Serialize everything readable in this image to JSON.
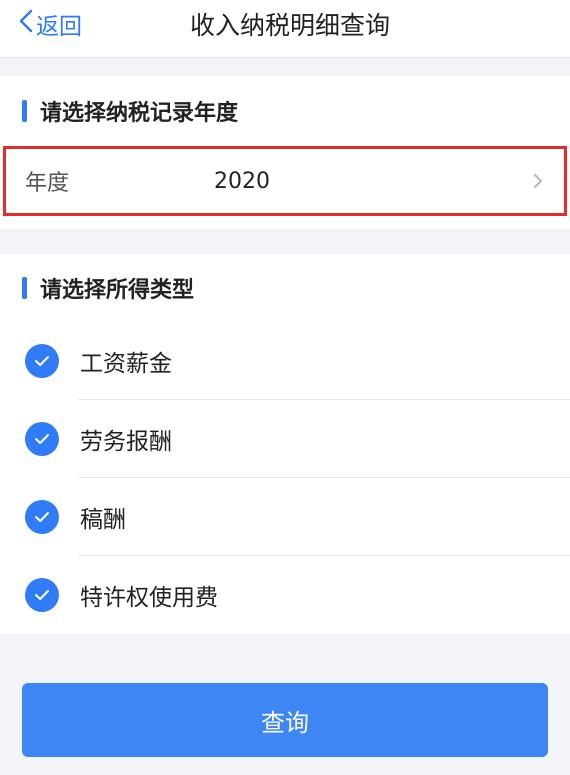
{
  "nav": {
    "back_label": "返回",
    "title": "收入纳税明细查询"
  },
  "year_section": {
    "title": "请选择纳税记录年度",
    "label": "年度",
    "value": "2020"
  },
  "type_section": {
    "title": "请选择所得类型",
    "items": [
      {
        "label": "工资薪金",
        "checked": true
      },
      {
        "label": "劳务报酬",
        "checked": true
      },
      {
        "label": "稿酬",
        "checked": true
      },
      {
        "label": "特许权使用费",
        "checked": true
      }
    ]
  },
  "query_button": {
    "label": "查询"
  },
  "colors": {
    "accent": "#2f7cf6",
    "highlight_border": "#e52b2b",
    "background": "#f3f4f8"
  },
  "icons": {
    "back": "chevron-left-icon",
    "row_arrow": "chevron-right-icon",
    "check": "check-circle-icon"
  }
}
